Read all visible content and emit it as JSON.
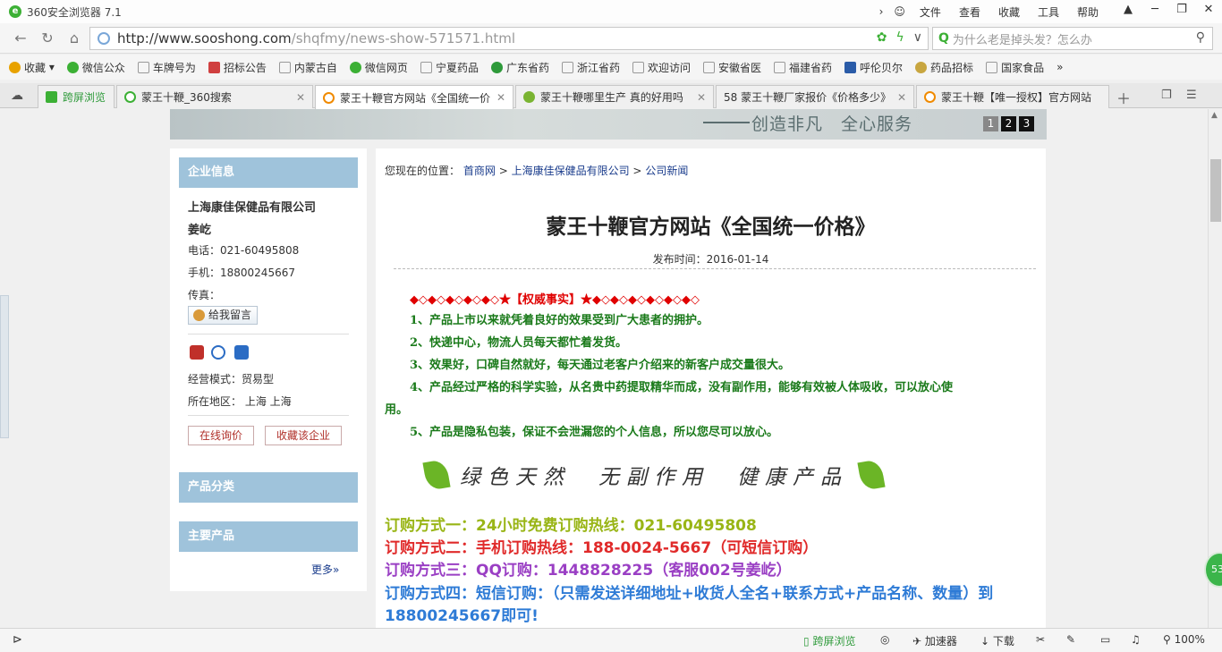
{
  "browser": {
    "title": "360安全浏览器 7.1",
    "menu": [
      "文件",
      "查看",
      "收藏",
      "工具",
      "帮助"
    ],
    "url_domain": "http://www.sooshong.com",
    "url_path": "/shqfmy/news-show-571571.html",
    "search_placeholder": "为什么老是掉头发？怎么办"
  },
  "bookmarks": [
    {
      "label": "收藏",
      "color": "#e8a200"
    },
    {
      "label": "微信公众",
      "color": "#3cb035"
    },
    {
      "label": "车牌号为",
      "color": "#dddddd"
    },
    {
      "label": "招标公告",
      "color": "#d04040"
    },
    {
      "label": "内蒙古自",
      "color": "#dddddd"
    },
    {
      "label": "微信网页",
      "color": "#3cb035"
    },
    {
      "label": "宁夏药品",
      "color": "#dddddd"
    },
    {
      "label": "广东省药",
      "color": "#2e9a3a"
    },
    {
      "label": "浙江省药",
      "color": "#dddddd"
    },
    {
      "label": "欢迎访问",
      "color": "#dddddd"
    },
    {
      "label": "安徽省医",
      "color": "#dddddd"
    },
    {
      "label": "福建省药",
      "color": "#dddddd"
    },
    {
      "label": "呼伦贝尔",
      "color": "#2b5ca8"
    },
    {
      "label": "药品招标",
      "color": "#c8a640"
    },
    {
      "label": "国家食品",
      "color": "#dddddd"
    }
  ],
  "tabs": [
    {
      "label": "跨屏浏览",
      "icon_color": "#3cb035"
    },
    {
      "label": "蒙王十鞭_360搜索",
      "icon_color": "#3cb035"
    },
    {
      "label": "蒙王十鞭官方网站《全国统一价",
      "icon_color": "#f08a00"
    },
    {
      "label": "蒙王十鞭哪里生产 真的好用吗",
      "icon_color": "#7ab432"
    },
    {
      "label": "58 蒙王十鞭厂家报价《价格多少》",
      "icon_color": "#f08a00"
    },
    {
      "label": "蒙王十鞭【唯一授权】官方网站",
      "icon_color": "#f08a00"
    }
  ],
  "banner": {
    "slogan": "创造非凡　全心服务",
    "pages": [
      "1",
      "2",
      "3"
    ]
  },
  "sidebar": {
    "company_head": "企业信息",
    "company_name": "上海康佳保健品有限公司",
    "contact": "姜屹",
    "phone": "电话：021-60495808",
    "mobile": "手机：18800245667",
    "fax": "传真：",
    "message_button": "给我留言",
    "mode": "经营模式：贸易型",
    "region": "所在地区：  上海 上海",
    "inquiry_button": "在线询价",
    "favorite_button": "收藏该企业",
    "category_head": "产品分类",
    "products_head": "主要产品",
    "more": "更多»"
  },
  "article": {
    "crumb_prefix": "您现在的位置：",
    "crumb_1": "首商网",
    "crumb_2": "上海康佳保健品有限公司",
    "crumb_3": "公司新闻",
    "sep": ">",
    "title": "蒙王十鞭官方网站《全国统一价格》",
    "date": "发布时间：2016-01-14",
    "highlight": "◆◇◆◇◆◇◆◇◆◇★【权威事实】★◆◇◆◇◆◇◆◇◆◇◆◇",
    "points": [
      "1、产品上市以来就凭着良好的效果受到广大患者的拥护。",
      "2、快递中心，物流人员每天都忙着发货。",
      "3、效果好，口碑自然就好，每天通过老客户介绍来的新客户成交量很大。",
      "4、产品经过严格的科学实验，从名贵中药提取精华而成，没有副作用，能够有效被人体吸收，可以放心使",
      "用。",
      "5、产品是隐私包装，保证不会泄漏您的个人信息，所以您尽可以放心。"
    ],
    "image_text": "绿色天然　无副作用　健康产品",
    "orders": [
      {
        "text": "订购方式一：24小时免费订购热线：021-60495808",
        "color": "#99b516"
      },
      {
        "text": "订购方式二：手机订购热线：188-0024-5667（可短信订购）",
        "color": "#e02a2a"
      },
      {
        "text": "订购方式三：QQ订购：1448828225（客服002号姜屹）",
        "color": "#9a3fc4"
      },
      {
        "text": "订购方式四：短信订购：（只需发送详细地址+收货人全名+联系方式+产品名称、数量）到",
        "color": "#2e7bd6"
      },
      {
        "text": "18800245667即可!",
        "color": "#2e7bd6"
      }
    ]
  },
  "status": {
    "cross_screen": "跨屏浏览",
    "accelerator": "加速器",
    "download": "下载",
    "zoom": "100%",
    "float_badge": "53"
  }
}
